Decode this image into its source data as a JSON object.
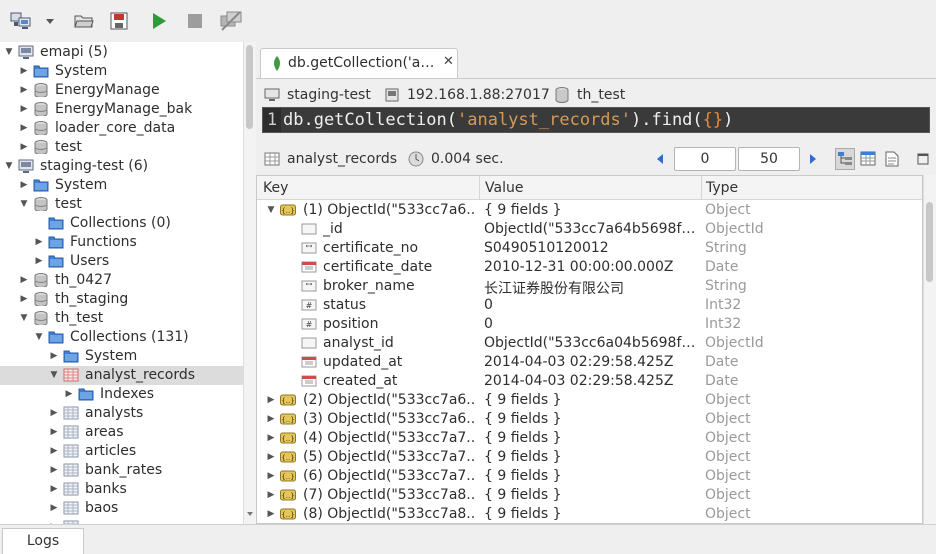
{
  "toolbar": {
    "buttons": [
      "connect",
      "open",
      "save",
      "execute",
      "stop",
      "disconnect"
    ]
  },
  "sidebar": {
    "rows": [
      {
        "label": "emapi (5)",
        "indent": 0,
        "twisty": "open",
        "icon": "server-icon"
      },
      {
        "label": "System",
        "indent": 1,
        "twisty": "closed",
        "icon": "folder-icon"
      },
      {
        "label": "EnergyManage",
        "indent": 1,
        "twisty": "closed",
        "icon": "database-icon"
      },
      {
        "label": "EnergyManage_bak",
        "indent": 1,
        "twisty": "closed",
        "icon": "database-icon"
      },
      {
        "label": "loader_core_data",
        "indent": 1,
        "twisty": "closed",
        "icon": "database-icon"
      },
      {
        "label": "test",
        "indent": 1,
        "twisty": "closed",
        "icon": "database-icon"
      },
      {
        "label": "staging-test (6)",
        "indent": 0,
        "twisty": "open",
        "icon": "server-icon"
      },
      {
        "label": "System",
        "indent": 1,
        "twisty": "closed",
        "icon": "folder-icon"
      },
      {
        "label": "test",
        "indent": 1,
        "twisty": "open",
        "icon": "database-icon"
      },
      {
        "label": "Collections (0)",
        "indent": 2,
        "twisty": "none",
        "icon": "folder-icon"
      },
      {
        "label": "Functions",
        "indent": 2,
        "twisty": "closed",
        "icon": "folder-icon"
      },
      {
        "label": "Users",
        "indent": 2,
        "twisty": "closed",
        "icon": "folder-icon"
      },
      {
        "label": "th_0427",
        "indent": 1,
        "twisty": "closed",
        "icon": "database-icon"
      },
      {
        "label": "th_staging",
        "indent": 1,
        "twisty": "closed",
        "icon": "database-icon"
      },
      {
        "label": "th_test",
        "indent": 1,
        "twisty": "open",
        "icon": "database-icon"
      },
      {
        "label": "Collections (131)",
        "indent": 2,
        "twisty": "open",
        "icon": "folder-icon"
      },
      {
        "label": "System",
        "indent": 3,
        "twisty": "closed",
        "icon": "folder-icon"
      },
      {
        "label": "analyst_records",
        "indent": 3,
        "twisty": "open",
        "icon": "table-red-icon",
        "selected": true
      },
      {
        "label": "Indexes",
        "indent": 4,
        "twisty": "closed",
        "icon": "folder-icon"
      },
      {
        "label": "analysts",
        "indent": 3,
        "twisty": "closed",
        "icon": "table-icon"
      },
      {
        "label": "areas",
        "indent": 3,
        "twisty": "closed",
        "icon": "table-icon"
      },
      {
        "label": "articles",
        "indent": 3,
        "twisty": "closed",
        "icon": "table-icon"
      },
      {
        "label": "bank_rates",
        "indent": 3,
        "twisty": "closed",
        "icon": "table-icon"
      },
      {
        "label": "banks",
        "indent": 3,
        "twisty": "closed",
        "icon": "table-icon"
      },
      {
        "label": "baos",
        "indent": 3,
        "twisty": "closed",
        "icon": "table-icon"
      },
      {
        "label": "",
        "indent": 3,
        "twisty": "closed",
        "icon": "table-icon"
      }
    ]
  },
  "tab": {
    "label": "db.getCollection('analyst_records').find({})",
    "close": "✕"
  },
  "connection": {
    "server": "staging-test",
    "host": "192.168.1.88:27017",
    "database": "th_test"
  },
  "editor": {
    "line_number": "1",
    "code_prefix": "db.getCollection(",
    "code_string": "'analyst_records'",
    "code_mid": ").find(",
    "code_arg": "{}",
    "code_suffix": ")"
  },
  "results": {
    "collection": "analyst_records",
    "time": "0.004 sec.",
    "skip": "0",
    "limit": "50"
  },
  "grid": {
    "headers": {
      "key": "Key",
      "value": "Value",
      "type": "Type"
    },
    "rows": [
      {
        "key": "(1) ObjectId(\"533cc7a6...",
        "value": "{ 9 fields }",
        "type": "Object",
        "level": 0,
        "twisty": "open",
        "icon": "object"
      },
      {
        "key": "_id",
        "value": "ObjectId(\"533cc7a64b5698f3...",
        "type": "ObjectId",
        "level": 1,
        "twisty": "none",
        "icon": "id"
      },
      {
        "key": "certificate_no",
        "value": "S0490510120012",
        "type": "String",
        "level": 1,
        "twisty": "none",
        "icon": "string"
      },
      {
        "key": "certificate_date",
        "value": "2010-12-31 00:00:00.000Z",
        "type": "Date",
        "level": 1,
        "twisty": "none",
        "icon": "date"
      },
      {
        "key": "broker_name",
        "value": "长江证券股份有限公司",
        "type": "String",
        "level": 1,
        "twisty": "none",
        "icon": "string"
      },
      {
        "key": "status",
        "value": "0",
        "type": "Int32",
        "level": 1,
        "twisty": "none",
        "icon": "int"
      },
      {
        "key": "position",
        "value": "0",
        "type": "Int32",
        "level": 1,
        "twisty": "none",
        "icon": "int"
      },
      {
        "key": "analyst_id",
        "value": "ObjectId(\"533cc6a04b5698f3...",
        "type": "ObjectId",
        "level": 1,
        "twisty": "none",
        "icon": "id"
      },
      {
        "key": "updated_at",
        "value": "2014-04-03 02:29:58.425Z",
        "type": "Date",
        "level": 1,
        "twisty": "none",
        "icon": "date"
      },
      {
        "key": "created_at",
        "value": "2014-04-03 02:29:58.425Z",
        "type": "Date",
        "level": 1,
        "twisty": "none",
        "icon": "date"
      },
      {
        "key": "(2) ObjectId(\"533cc7a6...",
        "value": "{ 9 fields }",
        "type": "Object",
        "level": 0,
        "twisty": "closed",
        "icon": "object"
      },
      {
        "key": "(3) ObjectId(\"533cc7a6...",
        "value": "{ 9 fields }",
        "type": "Object",
        "level": 0,
        "twisty": "closed",
        "icon": "object"
      },
      {
        "key": "(4) ObjectId(\"533cc7a7...",
        "value": "{ 9 fields }",
        "type": "Object",
        "level": 0,
        "twisty": "closed",
        "icon": "object"
      },
      {
        "key": "(5) ObjectId(\"533cc7a7...",
        "value": "{ 9 fields }",
        "type": "Object",
        "level": 0,
        "twisty": "closed",
        "icon": "object"
      },
      {
        "key": "(6) ObjectId(\"533cc7a7...",
        "value": "{ 9 fields }",
        "type": "Object",
        "level": 0,
        "twisty": "closed",
        "icon": "object"
      },
      {
        "key": "(7) ObjectId(\"533cc7a8...",
        "value": "{ 9 fields }",
        "type": "Object",
        "level": 0,
        "twisty": "closed",
        "icon": "object"
      },
      {
        "key": "(8) ObjectId(\"533cc7a8...",
        "value": "{ 9 fields }",
        "type": "Object",
        "level": 0,
        "twisty": "closed",
        "icon": "object"
      }
    ]
  },
  "logs": {
    "label": "Logs"
  },
  "colors": {
    "execute": "#2f9a3a",
    "folder": "#3d7fd6",
    "save": "#c0392b",
    "nav_arrow": "#2a6fd0",
    "mongo_leaf": "#3f9b3f"
  }
}
